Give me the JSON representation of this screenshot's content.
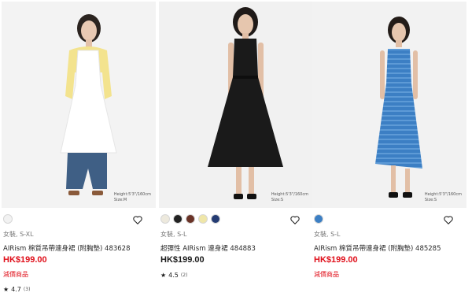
{
  "products": [
    {
      "measure_line1": "Height:5'3\"/160cm",
      "measure_line2": "Size:M",
      "swatches": [
        "#f2f2f2"
      ],
      "category": "女裝, S-XL",
      "name": "AIRism 棉質吊帶連身裙 (附胸墊) 483628",
      "price": "HK$199.00",
      "price_color": "red",
      "promo": "減價商品",
      "rating": "4.7",
      "rating_count": "(3)"
    },
    {
      "measure_line1": "Height:5'3\"/160cm",
      "measure_line2": "Size:S",
      "swatches": [
        "#ede9dd",
        "#222222",
        "#6a3327",
        "#efe6a8",
        "#243b73"
      ],
      "category": "女裝, S-L",
      "name": "超彈性 AIRism 連身裙 484883",
      "price": "HK$199.00",
      "price_color": "black",
      "promo": "",
      "rating": "4.5",
      "rating_count": "(2)"
    },
    {
      "measure_line1": "Height:5'3\"/160cm",
      "measure_line2": "Size:S",
      "swatches": [
        "#3c7fc4"
      ],
      "category": "女裝, S-L",
      "name": "AIRism 棉質吊帶連身裙 (附胸墊) 485285",
      "price": "HK$199.00",
      "price_color": "red",
      "promo": "減價商品",
      "rating": "",
      "rating_count": ""
    }
  ],
  "icons": {
    "favorite": "heart-outline-icon",
    "rating": "star-icon"
  },
  "colors": {
    "sale_red": "#e0101b",
    "text": "#1b1b1b",
    "muted": "#777777"
  }
}
